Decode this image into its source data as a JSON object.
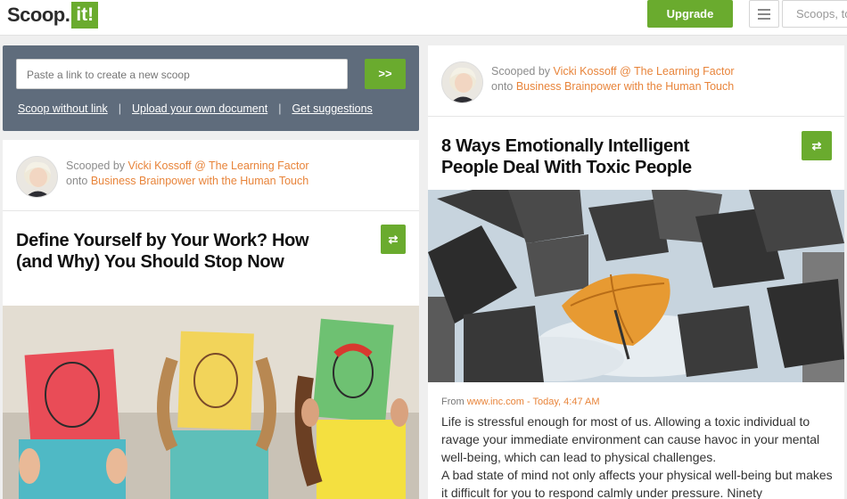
{
  "header": {
    "logo_text": "Scoop.",
    "logo_box": "it!",
    "upgrade_label": "Upgrade",
    "menu_icon": "hamburger-icon",
    "search_placeholder": "Scoops, topics"
  },
  "scoop_panel": {
    "input_placeholder": "Paste a link to create a new scoop",
    "go_label": ">>",
    "links": [
      "Scoop without link",
      "Upload your own document",
      "Get suggestions"
    ],
    "separator": "|"
  },
  "posts": [
    {
      "scooped_by_label": "Scooped by",
      "author": "Vicki Kossoff @ The Learning Factor",
      "onto_label": "onto",
      "topic": "Business Brainpower with the Human Touch",
      "title": "Define Yourself by Your Work? How (and Why) You Should Stop Now",
      "rescoop_icon": "rescoop-icon"
    },
    {
      "scooped_by_label": "Scooped by",
      "author": "Vicki Kossoff @ The Learning Factor",
      "onto_label": "onto",
      "topic": "Business Brainpower with the Human Touch",
      "title": "8 Ways Emotionally Intelligent People Deal With Toxic People",
      "rescoop_icon": "rescoop-icon",
      "source_from": "From",
      "source_site": "www.inc.com",
      "source_time": "- Today, 4:47 AM",
      "body": [
        "Life is stressful enough for most of us. Allowing a toxic individual to ravage your immediate environment can cause havoc in your mental well-being, which can lead to physical challenges.",
        "A bad state of mind not only affects your physical well-being but makes it difficult for you to respond calmly under pressure. Ninety"
      ]
    }
  ],
  "colors": {
    "brand_green": "#6aab2e",
    "panel_slate": "#5f6c7c",
    "link_orange": "#e8843a"
  }
}
